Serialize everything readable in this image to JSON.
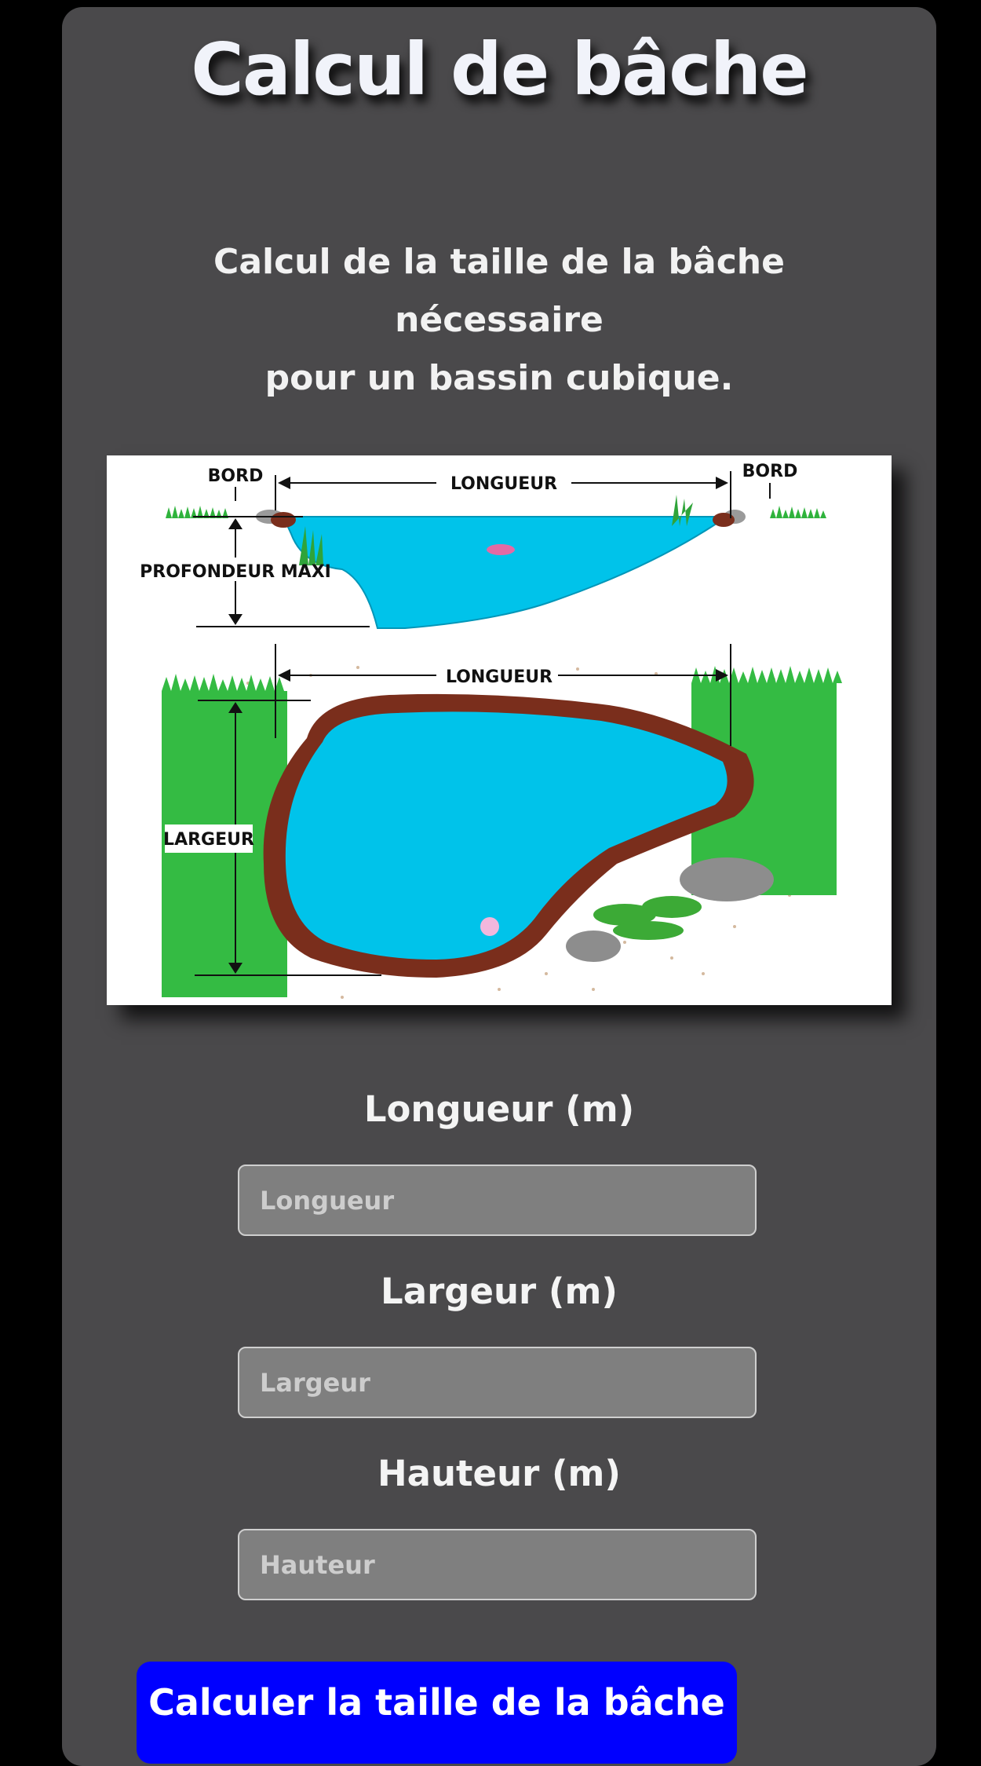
{
  "header": {
    "title": "Calcul de bâche"
  },
  "intro": {
    "line1": "Calcul de la taille de la bâche nécessaire",
    "line2": "pour un bassin cubique."
  },
  "diagram": {
    "labels": {
      "bord_left": "BORD",
      "bord_right": "BORD",
      "longueur_top": "LONGUEUR",
      "profondeur": "PROFONDEUR MAXI",
      "longueur_bottom": "LONGUEUR",
      "largeur": "LARGEUR"
    },
    "colors": {
      "water": "#00c3ea",
      "grass": "#2db83a",
      "stone": "#7a2e1c"
    }
  },
  "form": {
    "length": {
      "label": "Longueur (m)",
      "placeholder": "Longueur",
      "value": ""
    },
    "width": {
      "label": "Largeur (m)",
      "placeholder": "Largeur",
      "value": ""
    },
    "height": {
      "label": "Hauteur (m)",
      "placeholder": "Hauteur",
      "value": ""
    },
    "submit_label": "Calculer la taille de la bâche"
  },
  "theme": {
    "page_bg": "#000000",
    "card_bg": "#4a494b",
    "button_bg": "#0000ff",
    "input_bg": "#7f7f7f"
  }
}
